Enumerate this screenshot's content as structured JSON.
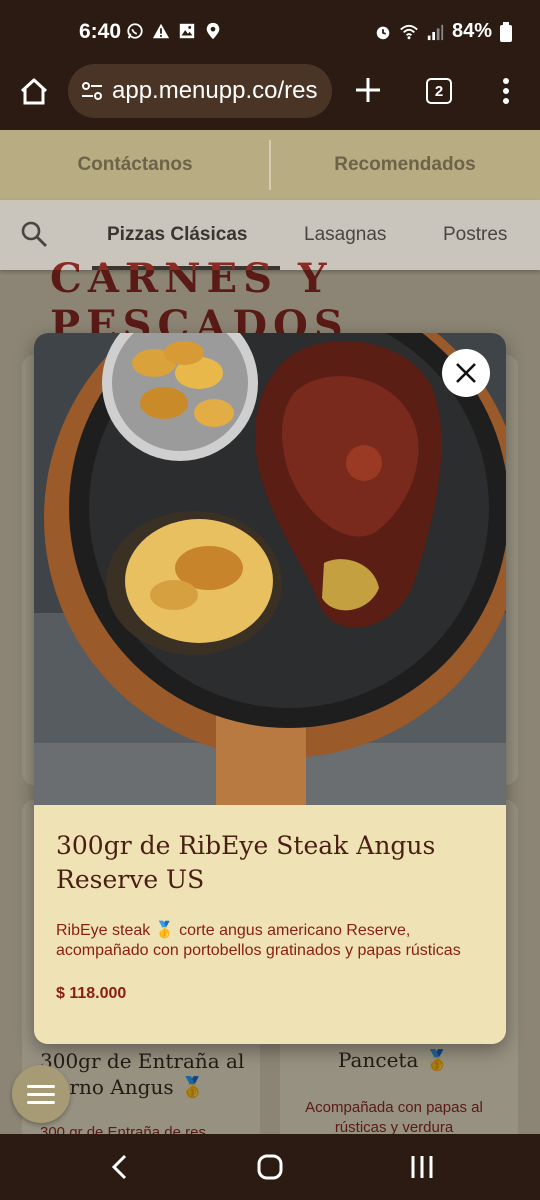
{
  "status_bar": {
    "time": "6:40",
    "battery": "84%",
    "left_icons": [
      "whatsapp-icon",
      "warning-icon",
      "image-icon",
      "location-icon"
    ],
    "right_icons": [
      "alarm-icon",
      "wifi-icon",
      "signal-icon",
      "battery-icon"
    ]
  },
  "browser": {
    "url": "app.menupp.co/res",
    "tab_count": "2"
  },
  "top_links": {
    "contact": "Contáctanos",
    "recommended": "Recomendados"
  },
  "categories": {
    "items": [
      "Pizzas Clásicas",
      "Lasagnas",
      "Postres"
    ],
    "active": "Pizzas Clásicas"
  },
  "section": {
    "title": "CARNES Y PESCADOS"
  },
  "background_cards": {
    "left_title": "300gr de Entraña al Horno Angus 🥇",
    "left_desc": "300 gr de Entraña de res",
    "right_title": "Panceta 🥇",
    "right_desc": "Acompañada con papas al rústicas y verdura"
  },
  "modal": {
    "title": "300gr de RibEye Steak Angus Reserve US",
    "description": "RibEye steak 🥇 corte angus americano Reserve, acompañado con portobellos gratinados y papas rústicas",
    "price": "$ 118.000"
  },
  "colors": {
    "chrome": "#2b1b12",
    "accent": "#8a1e12",
    "modal_bg": "#efe3b6"
  }
}
